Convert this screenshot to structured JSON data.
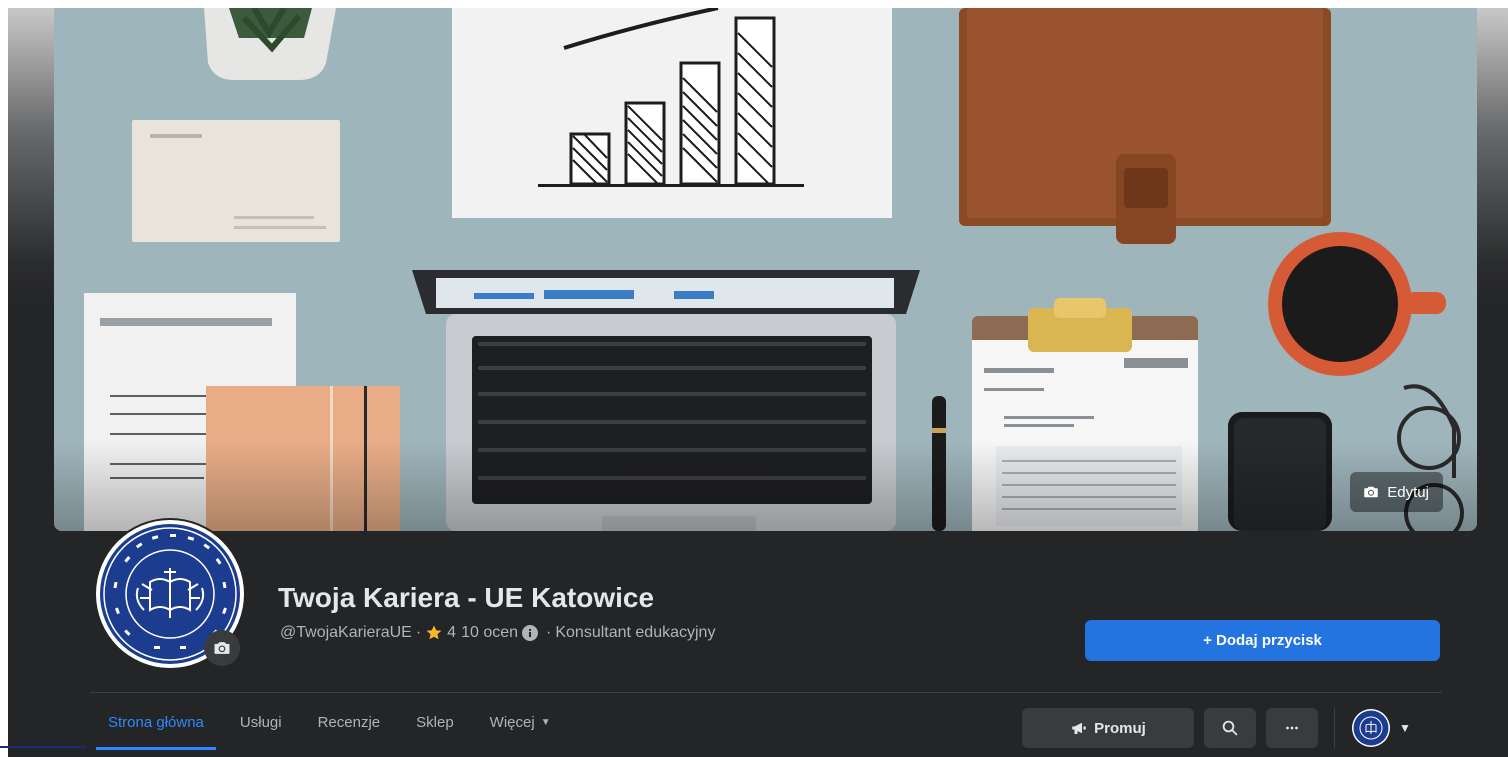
{
  "cover": {
    "edit_label": "Edytuj",
    "edit_icon": "camera-icon"
  },
  "profile": {
    "name": "Twoja Kariera - UE Katowice",
    "handle": "@TwojaKarieraUE",
    "rating_value": "4",
    "rating_count": "10 ocen",
    "category": "Konsultant edukacyjny",
    "avatar_icon": "university-seal-icon",
    "separator": "·"
  },
  "add_button": {
    "label": "+ Dodaj przycisk"
  },
  "tabs": [
    {
      "label": "Strona główna",
      "active": true
    },
    {
      "label": "Usługi"
    },
    {
      "label": "Recenzje"
    },
    {
      "label": "Sklep"
    },
    {
      "label": "Więcej"
    }
  ],
  "actions": {
    "promote_label": "Promuj",
    "search_icon": "search-icon",
    "more_icon": "more-dots-icon"
  },
  "colors": {
    "page_bg": "#242526",
    "accent": "#2374e1",
    "active_tab": "#2d88ff",
    "text_primary": "#e4e6eb",
    "text_secondary": "#b0b3b8",
    "rating_star": "#f7b928"
  }
}
